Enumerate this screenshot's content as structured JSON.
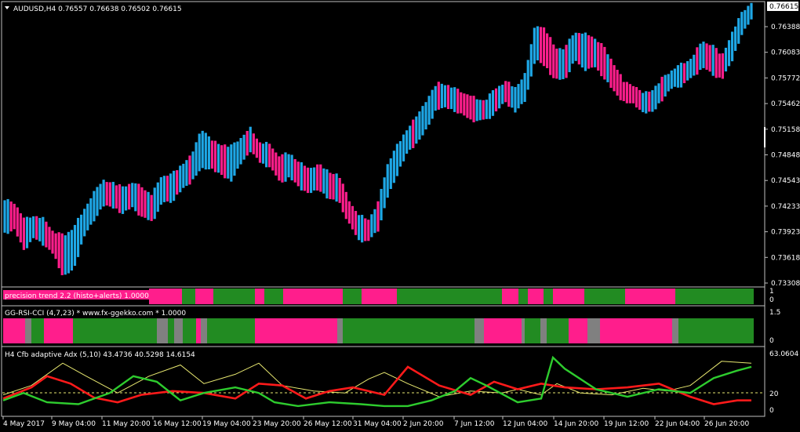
{
  "main": {
    "symbol_title": "AUDUSD,H4  0.76557 0.76638 0.76502 0.76615",
    "price_ticks": [
      "0.76615",
      "0.76388",
      "0.76083",
      "0.75772",
      "0.75462",
      "0.75158",
      "0.74848",
      "0.74543",
      "0.74233",
      "0.73923",
      "0.73618",
      "0.73308"
    ],
    "current_price": "0.76615",
    "colors": {
      "bull": "#1ea7e6",
      "bear": "#ff1e8c"
    }
  },
  "indicator1": {
    "title": "precision trend 2.2 (histo+alerts) 1.0000",
    "scale": [
      "1",
      "0"
    ],
    "colors": {
      "up": "#228b22",
      "down": "#ff1e8c"
    }
  },
  "indicator2": {
    "title": "GG-RSI-CCI (4,7,23) * www.fx-ggekko.com *  1.0000",
    "scale": [
      "1.5",
      "0"
    ],
    "colors": {
      "up": "#228b22",
      "down": "#ff1e8c",
      "neutral": "#808080"
    }
  },
  "indicator3": {
    "title": "H4 Cfb adaptive Adx (5,10) 43.4736 40.5298 14.6154",
    "scale": [
      "63.0604",
      "20",
      "0"
    ],
    "colors": {
      "adx": "#2ecc2e",
      "minus": "#ff1a1a",
      "plus": "#e8e870"
    }
  },
  "time_axis": [
    "4 May 2017",
    "9 May 04:00",
    "11 May 20:00",
    "16 May 12:00",
    "19 May 04:00",
    "23 May 20:00",
    "26 May 12:00",
    "31 May 04:00",
    "2 Jun 20:00",
    "7 Jun 12:00",
    "12 Jun 04:00",
    "14 Jun 20:00",
    "19 Jun 12:00",
    "22 Jun 04:00",
    "26 Jun 20:00"
  ],
  "chart_data": {
    "type": "bar",
    "title": "AUDUSD,H4",
    "ohlc_last": {
      "open": 0.76557,
      "high": 0.76638,
      "low": 0.76502,
      "close": 0.76615
    },
    "ylim": [
      0.7322,
      0.7666
    ],
    "x": [
      "4 May 2017",
      "9 May 04:00",
      "11 May 20:00",
      "16 May 12:00",
      "19 May 04:00",
      "23 May 20:00",
      "26 May 12:00",
      "31 May 04:00",
      "2 Jun 20:00",
      "7 Jun 12:00",
      "12 Jun 04:00",
      "14 Jun 20:00",
      "19 Jun 12:00",
      "22 Jun 04:00",
      "26 Jun 20:00"
    ],
    "closes": [
      0.7405,
      0.7408,
      0.7375,
      0.7392,
      0.7388,
      0.7372,
      0.7362,
      0.7372,
      0.7393,
      0.7418,
      0.7435,
      0.743,
      0.7425,
      0.7432,
      0.742,
      0.7414,
      0.744,
      0.7438,
      0.7452,
      0.7465,
      0.7475,
      0.7478,
      0.747,
      0.7462,
      0.7485,
      0.7502,
      0.7482,
      0.7478,
      0.7458,
      0.7468,
      0.7455,
      0.7448,
      0.7452,
      0.744,
      0.7438,
      0.741,
      0.739,
      0.7385,
      0.7402,
      0.7448,
      0.7475,
      0.75,
      0.751,
      0.7528,
      0.7558,
      0.7555,
      0.7548,
      0.754,
      0.7536,
      0.7538,
      0.7548,
      0.756,
      0.7543,
      0.7565,
      0.7622,
      0.761,
      0.7585,
      0.759,
      0.7615,
      0.76,
      0.7605,
      0.759,
      0.7572,
      0.7558,
      0.7552,
      0.7542,
      0.7548,
      0.7565,
      0.7575,
      0.758,
      0.7592,
      0.7605,
      0.7595,
      0.7585,
      0.761,
      0.7645,
      0.766
    ],
    "highs": [
      0.7425,
      0.742,
      0.74,
      0.7405,
      0.74,
      0.7385,
      0.738,
      0.739,
      0.741,
      0.7432,
      0.7448,
      0.7445,
      0.744,
      0.7445,
      0.744,
      0.743,
      0.7455,
      0.7455,
      0.7468,
      0.7478,
      0.7512,
      0.7498,
      0.7492,
      0.749,
      0.75,
      0.7512,
      0.7495,
      0.7492,
      0.7478,
      0.7482,
      0.747,
      0.7462,
      0.7468,
      0.7458,
      0.7455,
      0.7425,
      0.7405,
      0.74,
      0.742,
      0.747,
      0.7492,
      0.7512,
      0.7528,
      0.7548,
      0.7568,
      0.7566,
      0.756,
      0.7555,
      0.7548,
      0.7548,
      0.7562,
      0.757,
      0.7562,
      0.758,
      0.764,
      0.7635,
      0.7612,
      0.761,
      0.7632,
      0.7628,
      0.7625,
      0.7612,
      0.7592,
      0.757,
      0.7565,
      0.7555,
      0.756,
      0.7575,
      0.7585,
      0.7592,
      0.76,
      0.762,
      0.7615,
      0.7602,
      0.7628,
      0.7655,
      0.7666
    ],
    "lows": [
      0.7385,
      0.739,
      0.7365,
      0.738,
      0.7372,
      0.7358,
      0.7332,
      0.734,
      0.738,
      0.74,
      0.742,
      0.7418,
      0.741,
      0.7418,
      0.7405,
      0.74,
      0.7422,
      0.7425,
      0.7438,
      0.745,
      0.7465,
      0.7466,
      0.7458,
      0.745,
      0.747,
      0.7488,
      0.7472,
      0.7468,
      0.7448,
      0.7454,
      0.7442,
      0.7435,
      0.744,
      0.7428,
      0.7425,
      0.7398,
      0.7378,
      0.7375,
      0.739,
      0.743,
      0.746,
      0.7485,
      0.7498,
      0.7515,
      0.754,
      0.754,
      0.7536,
      0.7528,
      0.7524,
      0.7525,
      0.7535,
      0.7548,
      0.7535,
      0.755,
      0.76,
      0.7592,
      0.7575,
      0.7575,
      0.7598,
      0.7588,
      0.759,
      0.7578,
      0.756,
      0.7548,
      0.7545,
      0.7535,
      0.7535,
      0.7552,
      0.7565,
      0.7568,
      0.7578,
      0.759,
      0.7582,
      0.7575,
      0.7598,
      0.763,
      0.765
    ]
  }
}
